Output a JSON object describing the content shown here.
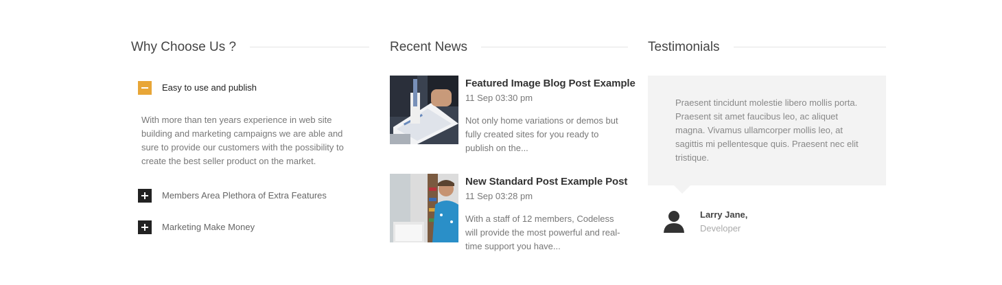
{
  "why_choose": {
    "title": "Why Choose Us ?",
    "items": [
      {
        "label": "Easy to use and publish",
        "state": "open",
        "body": "With more than ten years experience in web site building and marketing campaigns we are able and sure to provide our customers with the possibility to create the best seller product on the market."
      },
      {
        "label": "Members Area Plethora of Extra Features",
        "state": "closed"
      },
      {
        "label": "Marketing Make Money",
        "state": "closed"
      }
    ],
    "accent_color": "#e8a637"
  },
  "recent_news": {
    "title": "Recent News",
    "posts": [
      {
        "title": "Featured Image Blog Post Example",
        "date": "11 Sep 03:30 pm",
        "excerpt": "Not only home variations or demos but fully created sites for you ready to publish on the..."
      },
      {
        "title": "New Standard Post Example Post",
        "date": "11 Sep 03:28 pm",
        "excerpt": "With a staff of 12 members, Codeless will provide the most powerful and real-time support you have..."
      }
    ]
  },
  "testimonials": {
    "title": "Testimonials",
    "quote": "Praesent tincidunt molestie libero mollis porta. Praesent sit amet faucibus leo, ac aliquet magna. Vivamus ullamcorper mollis leo, at sagittis mi pellentesque quis. Praesent nec elit tristique.",
    "author_name": "Larry Jane,",
    "author_role": "Developer"
  },
  "icons": {
    "open_toggle": "minus-icon",
    "closed_toggle": "plus-icon",
    "avatar": "user-silhouette-icon"
  }
}
